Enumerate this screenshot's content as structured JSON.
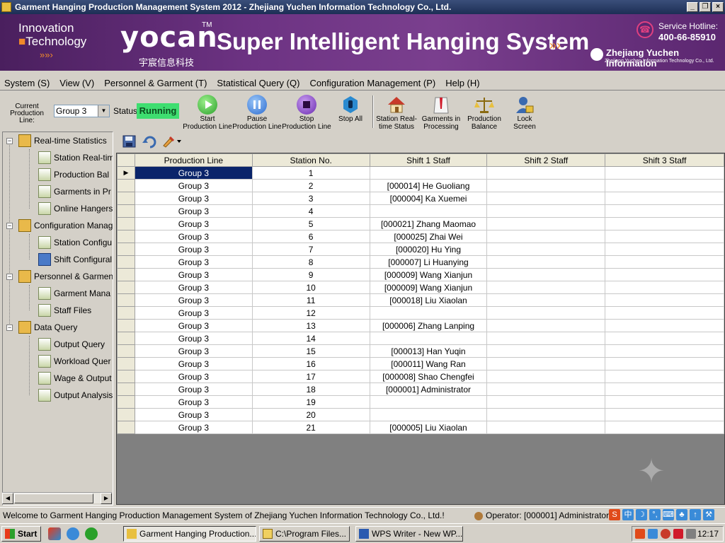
{
  "window": {
    "title": "Garment Hanging Production Management System 2012 - Zhejiang Yuchen Information Technology Co., Ltd.",
    "buttons": [
      "_",
      "❐",
      "×"
    ]
  },
  "banner": {
    "innovation": "Innovation",
    "technology": "Technology",
    "arrows": "»»›",
    "logo": "yocan",
    "logo_tm": "TM",
    "logo_cn": "宇宸信息科技",
    "slogan": "Super Intelligent Hanging System",
    "slogan_arrows": "»›",
    "hotline_label": "Service Hotline:",
    "hotline": "400-66-85910",
    "company": "Zhejiang Yuchen Information",
    "company_en": "Zhejiang Yuchen Information Technology Co., Ltd."
  },
  "menu": [
    "System (S)",
    "View (V)",
    "Personnel & Garment (T)",
    "Statistical Query (Q)",
    "Configuration Management (P)",
    "Help (H)"
  ],
  "toolbar": {
    "production_line_label": "Current Production Line:",
    "production_line_value": "Group 3",
    "status_label": "Status:",
    "status_value": "Running",
    "buttons": [
      {
        "label": "Start Production Line",
        "icon": "play-icon"
      },
      {
        "label": "Pause Production Line",
        "icon": "pause-icon"
      },
      {
        "label": "Stop Production Line",
        "icon": "stop-icon"
      },
      {
        "label": "Stop All",
        "icon": "hand-icon"
      },
      {
        "label": "Station Real-time Status",
        "icon": "house-icon"
      },
      {
        "label": "Garments in Processing",
        "icon": "garment-icon"
      },
      {
        "label": "Production Balance",
        "icon": "scale-icon"
      },
      {
        "label": "Lock Screen",
        "icon": "lock-user-icon"
      }
    ]
  },
  "tree": {
    "groups": [
      {
        "label": "Real-time Statistics",
        "children": [
          "Station Real-tim",
          "Production Bal",
          "Garments in Pr",
          "Online Hangers"
        ]
      },
      {
        "label": "Configuration Manag",
        "children": [
          "Station Configu",
          "Shift Configural"
        ]
      },
      {
        "label": "Personnel & Garmen",
        "children": [
          "Garment Mana",
          "Staff Files"
        ]
      },
      {
        "label": "Data Query",
        "children": [
          "Output Query",
          "Workload Quer",
          "Wage & Output",
          "Output Analysis"
        ]
      }
    ]
  },
  "grid": {
    "columns": [
      "Production Line",
      "Station No.",
      "Shift 1 Staff",
      "Shift 2 Staff",
      "Shift 3 Staff"
    ],
    "rows": [
      [
        "Group 3",
        "1",
        "",
        "",
        ""
      ],
      [
        "Group 3",
        "2",
        "[000014] He Guoliang",
        "",
        ""
      ],
      [
        "Group 3",
        "3",
        "[000004] Ka Xuemei",
        "",
        ""
      ],
      [
        "Group 3",
        "4",
        "",
        "",
        ""
      ],
      [
        "Group 3",
        "5",
        "[000021] Zhang Maomao",
        "",
        ""
      ],
      [
        "Group 3",
        "6",
        "[000025] Zhai Wei",
        "",
        ""
      ],
      [
        "Group 3",
        "7",
        "[000020] Hu Ying",
        "",
        ""
      ],
      [
        "Group 3",
        "8",
        "[000007] Li Huanying",
        "",
        ""
      ],
      [
        "Group 3",
        "9",
        "[000009] Wang Xianjun",
        "",
        ""
      ],
      [
        "Group 3",
        "10",
        "[000009] Wang Xianjun",
        "",
        ""
      ],
      [
        "Group 3",
        "11",
        "[000018] Liu Xiaolan",
        "",
        ""
      ],
      [
        "Group 3",
        "12",
        "",
        "",
        ""
      ],
      [
        "Group 3",
        "13",
        "[000006] Zhang Lanping",
        "",
        ""
      ],
      [
        "Group 3",
        "14",
        "",
        "",
        ""
      ],
      [
        "Group 3",
        "15",
        "[000013] Han Yuqin",
        "",
        ""
      ],
      [
        "Group 3",
        "16",
        "[000011] Wang Ran",
        "",
        ""
      ],
      [
        "Group 3",
        "17",
        "[000008] Shao Chengfei",
        "",
        ""
      ],
      [
        "Group 3",
        "18",
        "[000001] Administrator",
        "",
        ""
      ],
      [
        "Group 3",
        "19",
        "",
        "",
        ""
      ],
      [
        "Group 3",
        "20",
        "",
        "",
        ""
      ],
      [
        "Group 3",
        "21",
        "[000005] Liu Xiaolan",
        "",
        ""
      ]
    ],
    "current_row_marker": "▶"
  },
  "statusbar": {
    "welcome": "Welcome to Garment Hanging Production Management System of Zhejiang Yuchen Information Technology Co., Ltd.!",
    "operator": "Operator: [000001] Administrator",
    "ime": [
      "S",
      "中",
      "☽",
      "°,",
      "⌨",
      "♣",
      "↑",
      "⚒"
    ]
  },
  "taskbar": {
    "start": "Start",
    "tasks": [
      "Garment Hanging Production...",
      "C:\\Program Files...",
      "WPS Writer - New WP..."
    ],
    "clock": "12:17"
  },
  "colors": {
    "banner": "#6d3383",
    "status_running": "#3ede70",
    "selection": "#0a246a"
  }
}
